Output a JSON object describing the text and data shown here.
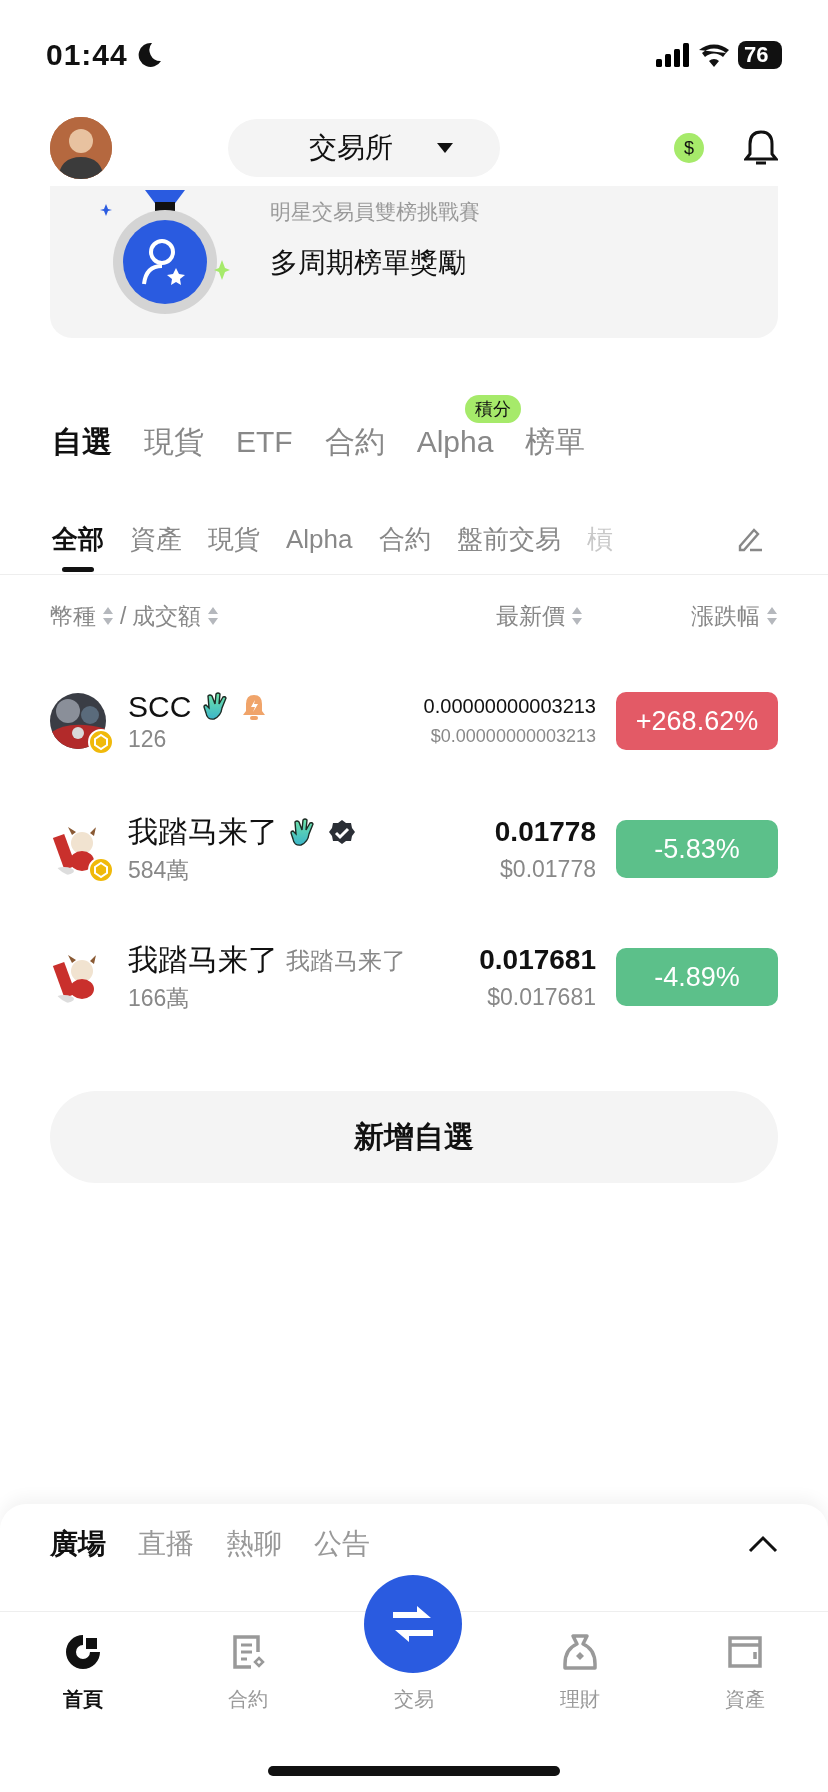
{
  "status_bar": {
    "time": "01:44",
    "battery": "76"
  },
  "header": {
    "exchange_selector": "交易所",
    "rewards_symbol": "$"
  },
  "banner": {
    "subtitle": "明星交易員雙榜挑戰賽",
    "title": "多周期榜單獎勵"
  },
  "market_tabs": [
    {
      "label": "自選",
      "selected": true
    },
    {
      "label": "現貨",
      "selected": false
    },
    {
      "label": "ETF",
      "selected": false
    },
    {
      "label": "合約",
      "selected": false
    },
    {
      "label": "Alpha",
      "selected": false,
      "badge": "積分"
    },
    {
      "label": "榜單",
      "selected": false
    }
  ],
  "filter_tabs": [
    {
      "label": "全部",
      "selected": true
    },
    {
      "label": "資產",
      "selected": false
    },
    {
      "label": "現貨",
      "selected": false
    },
    {
      "label": "Alpha",
      "selected": false
    },
    {
      "label": "合約",
      "selected": false
    },
    {
      "label": "盤前交易",
      "selected": false
    },
    {
      "label": "槓",
      "selected": false
    }
  ],
  "columns": {
    "coin": "幣種",
    "separator": "/",
    "volume": "成交額",
    "price": "最新價",
    "change": "漲跌幅"
  },
  "rows": [
    {
      "name": "SCC",
      "badges": [
        {
          "kind": "hand"
        },
        {
          "kind": "alert"
        }
      ],
      "chain_badge": true,
      "volume": "126",
      "price": "0.00000000003213",
      "price_usd": "$0.00000000003213",
      "change": "+268.62%",
      "color": "#e35a66"
    },
    {
      "name": "我踏马来了",
      "badges": [
        {
          "kind": "hand"
        },
        {
          "kind": "verified"
        }
      ],
      "chain_badge": true,
      "volume": "584萬",
      "price": "0.01778",
      "price_usd": "$0.01778",
      "change": "-5.83%",
      "color": "#5cc08a"
    },
    {
      "name": "我踏马来了",
      "tag": "我踏马来了",
      "chain_badge": false,
      "volume": "166萬",
      "price": "0.017681",
      "price_usd": "$0.017681",
      "change": "-4.89%",
      "color": "#5cc08a"
    }
  ],
  "add_button": "新增自選",
  "feed_tabs": [
    {
      "label": "廣場",
      "selected": true
    },
    {
      "label": "直播",
      "selected": false
    },
    {
      "label": "熱聊",
      "selected": false
    },
    {
      "label": "公告",
      "selected": false
    }
  ],
  "nav": [
    {
      "label": "首頁",
      "kind": "home",
      "selected": true
    },
    {
      "label": "合約",
      "kind": "futures",
      "selected": false
    },
    {
      "label": "交易",
      "kind": "trade",
      "selected": false
    },
    {
      "label": "理財",
      "kind": "earn",
      "selected": false
    },
    {
      "label": "資產",
      "kind": "assets",
      "selected": false
    }
  ]
}
